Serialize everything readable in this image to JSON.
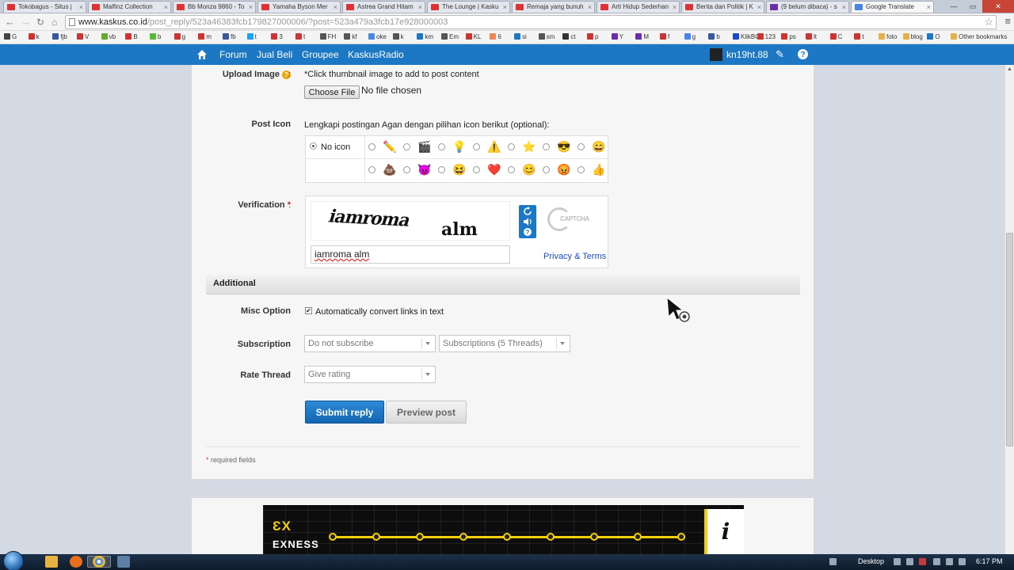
{
  "browser": {
    "tabs": [
      {
        "title": "Tokobagus - Situs j",
        "fav": "red"
      },
      {
        "title": "Malfinz Collection",
        "fav": "red"
      },
      {
        "title": "Bb Monza 9860 - To",
        "fav": "red"
      },
      {
        "title": "Yamaha Byson Mer",
        "fav": "red"
      },
      {
        "title": "Astrea Grand Hitam",
        "fav": "red"
      },
      {
        "title": "The Lounge | Kasku",
        "fav": "red"
      },
      {
        "title": "Remaja yang bunuh",
        "fav": "red"
      },
      {
        "title": "Arti Hidup Sederhan",
        "fav": "red"
      },
      {
        "title": "Berita dan Politik | K",
        "fav": "red"
      },
      {
        "title": "(9 belum dibaca) - s",
        "fav": "ym"
      },
      {
        "title": "Google Translate",
        "fav": "gt"
      }
    ],
    "url_host": "www.kaskus.co.id",
    "url_path": "/post_reply/523a46383fcb179827000006/?post=523a479a3fcb17e928000003",
    "bookmarks": [
      "G",
      "k",
      "fjb",
      "V",
      "vb",
      "B",
      "b",
      "g",
      "m",
      "fb",
      "t",
      "3",
      "t",
      "FH",
      "kf",
      "oke",
      "k",
      "km",
      "Em",
      "KL",
      "6",
      "si",
      "sm",
      "ct",
      "p",
      "Y",
      "M",
      "f",
      "g",
      "b",
      "KlikBCA",
      "123",
      "ps",
      "lt",
      "C",
      "t",
      "foto",
      "blog",
      "O"
    ],
    "other_bookmarks": "Other bookmarks"
  },
  "sitenav": {
    "items": [
      "Forum",
      "Jual Beli",
      "Groupee",
      "KaskusRadio"
    ],
    "username": "kn19ht.88"
  },
  "form": {
    "upload": {
      "label": "Upload Image",
      "hint": "*Click thumbnail image to add to post content",
      "button": "Choose File",
      "status": "No file chosen"
    },
    "post_icon": {
      "label": "Post Icon",
      "desc": "Lengkapi postingan Agan dengan pilihan icon berikut (optional):",
      "no_icon": "No icon",
      "row1": [
        "pencil",
        "clapper",
        "bulb",
        "warning",
        "star",
        "cool",
        "smile"
      ],
      "row2": [
        "poop",
        "devil",
        "grin",
        "heart",
        "shy",
        "angry",
        "thumb"
      ]
    },
    "verification": {
      "label": "Verification",
      "captcha_word1": "iamroma",
      "captcha_word2": "alm",
      "input_value": "iamroma alm",
      "privacy": "Privacy & Terms",
      "logo": "CAPTCHA"
    },
    "additional": {
      "header": "Additional",
      "misc_label": "Misc Option",
      "misc_text": "Automatically convert links in text",
      "subscription_label": "Subscription",
      "subscription_value": "Do not subscribe",
      "subscriptions_value": "Subscriptions (5 Threads)",
      "rate_label": "Rate Thread",
      "rate_value": "Give rating"
    },
    "submit": "Submit reply",
    "preview": "Preview post",
    "required_note": "required fields"
  },
  "ad": {
    "brand": "EXNESS",
    "logo_mark": "ƐX",
    "info": "i"
  },
  "taskbar": {
    "desktop": "Desktop",
    "clock": "6:17 PM"
  },
  "colors": {
    "nav_blue": "#1c78c4",
    "submit_blue": "#1466b0",
    "ad_yellow": "#f4d007"
  }
}
